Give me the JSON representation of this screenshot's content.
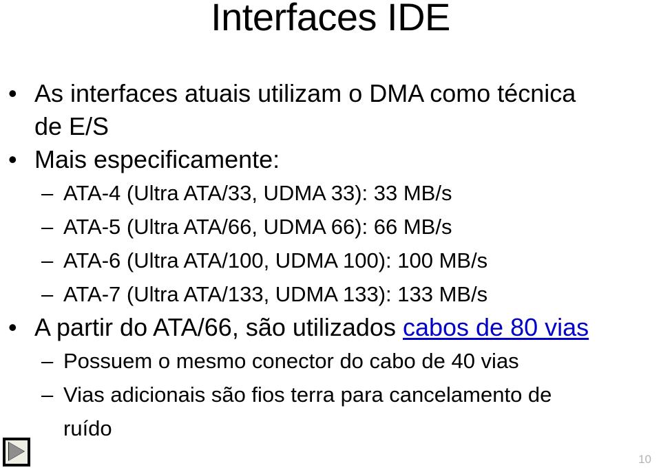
{
  "slide": {
    "title": "Interfaces IDE",
    "page_number": "10",
    "background_color": "#ffffff",
    "text_color": "#000000",
    "link_color": "#0000c8",
    "page_number_color": "#b4b4b4"
  },
  "bullet_markers": {
    "level1": "•",
    "level2": "–"
  },
  "content": [
    {
      "level": 1,
      "text": "As interfaces atuais utilizam o DMA como técnica",
      "continuation": "de E/S"
    },
    {
      "level": 1,
      "text": "Mais especificamente:"
    },
    {
      "level": 2,
      "text": "ATA-4 (Ultra  ATA/33, UDMA 33): 33 MB/s"
    },
    {
      "level": 2,
      "text": "ATA-5 (Ultra ATA/66, UDMA 66): 66 MB/s"
    },
    {
      "level": 2,
      "text": "ATA-6 (Ultra ATA/100, UDMA 100): 100 MB/s"
    },
    {
      "level": 2,
      "text": "ATA-7 (Ultra ATA/133, UDMA 133): 133 MB/s"
    },
    {
      "level": 1,
      "text": "A partir do ATA/66, são utilizados ",
      "link_text": "cabos de 80 vias"
    },
    {
      "level": 2,
      "text": "Possuem o mesmo conector do cabo de 40 vias"
    },
    {
      "level": 2,
      "text": "Vias adicionais são fios terra para cancelamento de",
      "continuation": "ruído"
    }
  ],
  "media_button": {
    "icon": "play-triangle-icon",
    "border_color": "#000000",
    "face_color": "#efeee4",
    "triangle_color": "#8e8e8e"
  }
}
